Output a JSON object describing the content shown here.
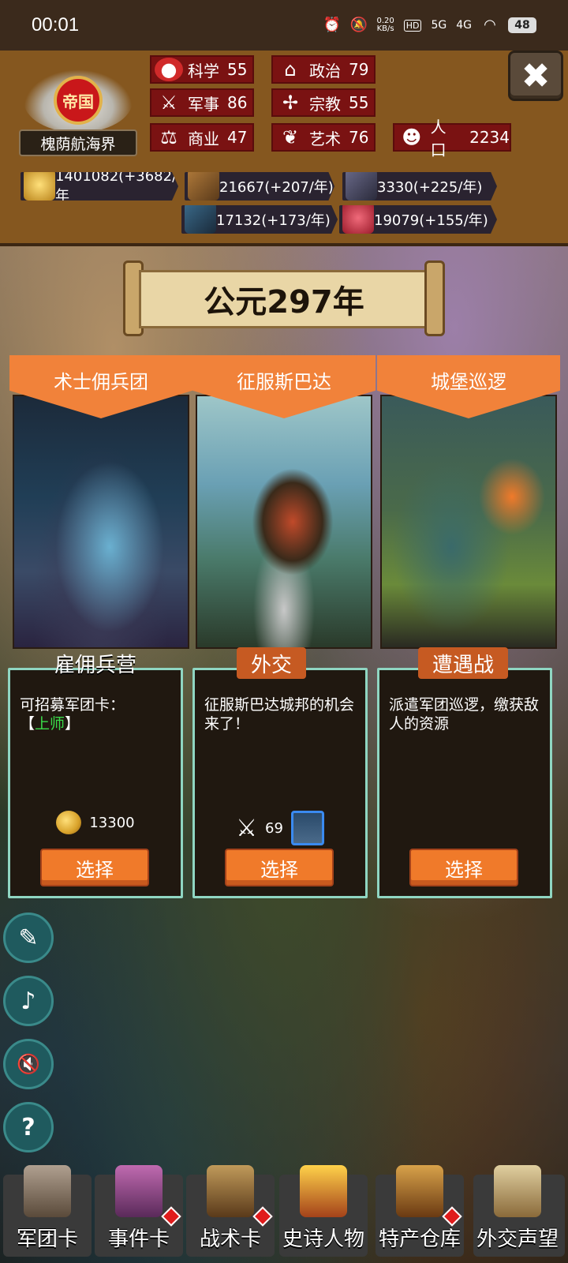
{
  "status_bar": {
    "time": "00:01",
    "net_speed_value": "0.20",
    "net_speed_unit": "KB/s",
    "hd_label": "HD",
    "sig1": "5G",
    "sig2": "4G",
    "battery": "48"
  },
  "header": {
    "emblem_text": "帝国",
    "empire_name": "槐荫航海界",
    "stats": [
      {
        "label": "科学",
        "value": "55",
        "icon": "science-icon"
      },
      {
        "label": "政治",
        "value": "79",
        "icon": "politics-icon"
      },
      {
        "label": "军事",
        "value": "86",
        "icon": "military-icon"
      },
      {
        "label": "宗教",
        "value": "55",
        "icon": "religion-icon"
      },
      {
        "label": "商业",
        "value": "47",
        "icon": "commerce-icon"
      },
      {
        "label": "艺术",
        "value": "76",
        "icon": "art-icon"
      },
      {
        "label": "人口",
        "value": "2234",
        "icon": "population-icon"
      }
    ],
    "resources": [
      {
        "text": "1401082(+3682/年",
        "icon": "gold-icon",
        "color": "#d8a22a"
      },
      {
        "text": "21667(+207/年)",
        "icon": "wood-icon",
        "color": "#8a5a2a"
      },
      {
        "text": "3330(+225/年)",
        "icon": "stone-icon",
        "color": "#5a5a7a"
      },
      {
        "text": "17132(+173/年)",
        "icon": "iron-icon",
        "color": "#2a4a6a"
      },
      {
        "text": "19079(+155/年)",
        "icon": "meat-icon",
        "color": "#c0303a"
      }
    ],
    "close_symbol": "✖"
  },
  "year_banner": "公元297年",
  "cards": [
    {
      "ribbon": "术士佣兵团",
      "tag": "雇佣兵营",
      "desc": "可招募军团卡：",
      "desc_bracket_open": "【",
      "desc_highlight": "上师",
      "desc_bracket_close": "】",
      "cost_value": "13300",
      "button": "选择"
    },
    {
      "ribbon": "征服斯巴达",
      "tag": "外交",
      "desc": "征服斯巴达城邦的机会来了！",
      "requirement_value": "69",
      "button": "选择"
    },
    {
      "ribbon": "城堡巡逻",
      "tag": "遭遇战",
      "desc": "派遣军团巡逻，缴获敌人的资源",
      "button": "选择"
    }
  ],
  "side_buttons": [
    {
      "name": "quest-log-icon",
      "glyph": "✎"
    },
    {
      "name": "music-off-icon",
      "glyph": "♪"
    },
    {
      "name": "sound-off-icon",
      "glyph": "🔇"
    },
    {
      "name": "help-icon",
      "glyph": "?"
    }
  ],
  "bottom_nav": [
    {
      "label": "军团卡",
      "icon": "helmet-icon",
      "color": "#8a7a6a",
      "badge": false
    },
    {
      "label": "事件卡",
      "icon": "scroll-icon",
      "color": "#9a4a8a",
      "badge": true
    },
    {
      "label": "战术卡",
      "icon": "shield-swords-icon",
      "color": "#8a6a3a",
      "badge": true
    },
    {
      "label": "史诗人物",
      "icon": "crown-icon",
      "color": "#d8a22a",
      "badge": false
    },
    {
      "label": "特产仓库",
      "icon": "chest-icon",
      "color": "#a4742a",
      "badge": true
    },
    {
      "label": "外交声望",
      "icon": "envelope-icon",
      "color": "#c9b48a",
      "badge": false
    }
  ]
}
